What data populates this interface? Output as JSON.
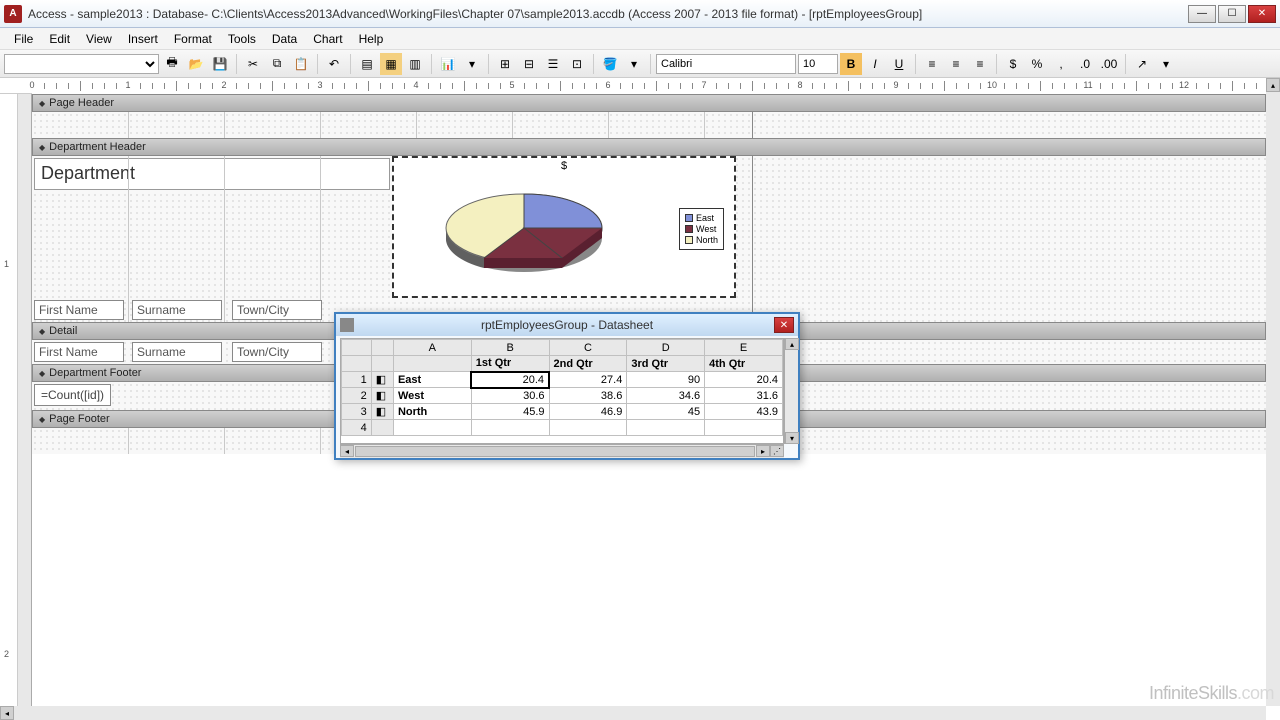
{
  "window": {
    "title": "Access - sample2013 : Database- C:\\Clients\\Access2013Advanced\\WorkingFiles\\Chapter 07\\sample2013.accdb (Access 2007 - 2013 file format) - [rptEmployeesGroup]"
  },
  "menu": [
    "File",
    "Edit",
    "View",
    "Insert",
    "Format",
    "Tools",
    "Data",
    "Chart",
    "Help"
  ],
  "toolbar": {
    "font": "Calibri",
    "size": "10"
  },
  "sections": {
    "page_header": "Page Header",
    "dept_header": "Department Header",
    "detail": "Detail",
    "dept_footer": "Department Footer",
    "page_footer": "Page Footer"
  },
  "fields": {
    "department_label": "Department",
    "first_name": "First Name",
    "surname": "Surname",
    "town_city": "Town/City",
    "count_expr": "=Count([id])"
  },
  "chart": {
    "title": "$",
    "legend": [
      "East",
      "West",
      "North"
    ]
  },
  "chart_data": {
    "type": "pie",
    "title": "$",
    "categories": [
      "East",
      "West",
      "North"
    ],
    "values": [
      20.4,
      30.6,
      45.9
    ],
    "legend_position": "right",
    "note": "Pie appears to show 1st Qtr values from datasheet"
  },
  "datasheet": {
    "title": "rptEmployeesGroup - Datasheet",
    "cols": [
      "A",
      "B",
      "C",
      "D",
      "E"
    ],
    "headers": [
      "",
      "1st Qtr",
      "2nd Qtr",
      "3rd Qtr",
      "4th Qtr"
    ],
    "rows": [
      {
        "n": "1",
        "label": "East",
        "v": [
          "20.4",
          "27.4",
          "90",
          "20.4"
        ]
      },
      {
        "n": "2",
        "label": "West",
        "v": [
          "30.6",
          "38.6",
          "34.6",
          "31.6"
        ]
      },
      {
        "n": "3",
        "label": "North",
        "v": [
          "45.9",
          "46.9",
          "45",
          "43.9"
        ]
      },
      {
        "n": "4",
        "label": "",
        "v": [
          "",
          "",
          "",
          ""
        ]
      }
    ],
    "selected": {
      "row": 0,
      "col": 0
    }
  },
  "watermark": {
    "a": "InfiniteSkills",
    "b": ".com"
  }
}
